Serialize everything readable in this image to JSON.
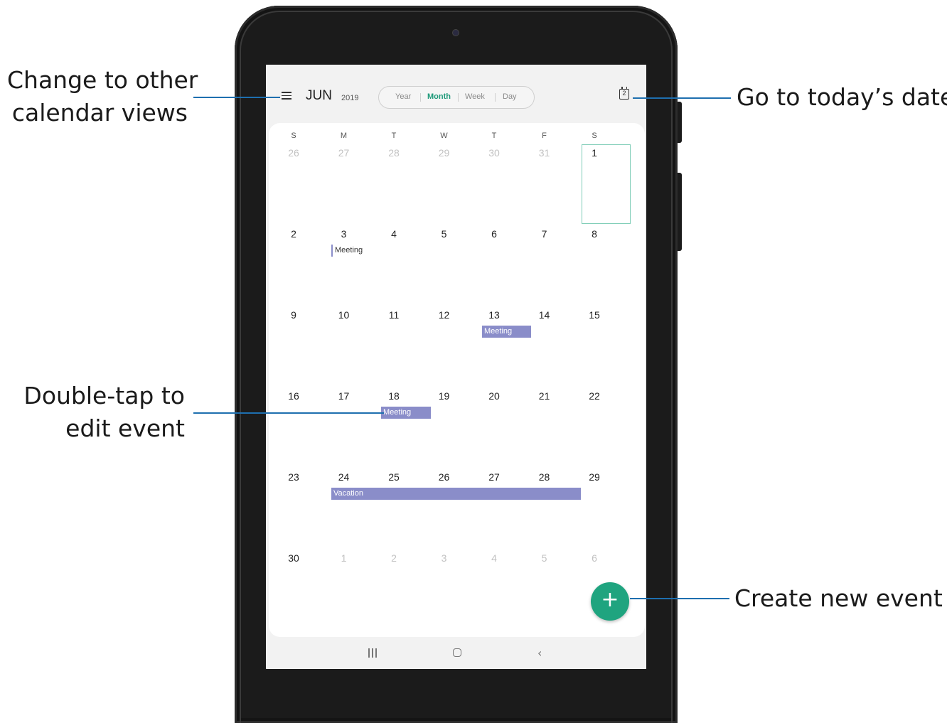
{
  "callouts": {
    "views_line1": "Change to other",
    "views_line2": "calendar views",
    "today": "Go to today’s date",
    "edit_line1": "Double-tap to",
    "edit_line2": "edit event",
    "create": "Create new event"
  },
  "header": {
    "month": "JUN",
    "year": "2019",
    "views": [
      "Year",
      "Month",
      "Week",
      "Day"
    ],
    "active_view": "Month",
    "today_icon_day": "2"
  },
  "weekdays": [
    "S",
    "M",
    "T",
    "W",
    "T",
    "F",
    "S"
  ],
  "weeks": [
    [
      "26",
      "27",
      "28",
      "29",
      "30",
      "31",
      "1"
    ],
    [
      "2",
      "3",
      "4",
      "5",
      "6",
      "7",
      "8"
    ],
    [
      "9",
      "10",
      "11",
      "12",
      "13",
      "14",
      "15"
    ],
    [
      "16",
      "17",
      "18",
      "19",
      "20",
      "21",
      "22"
    ],
    [
      "23",
      "24",
      "25",
      "26",
      "27",
      "28",
      "29"
    ],
    [
      "30",
      "1",
      "2",
      "3",
      "4",
      "5",
      "6"
    ]
  ],
  "events": {
    "meeting_3": "Meeting",
    "meeting_13": "Meeting",
    "meeting_18": "Meeting",
    "vacation": "Vacation"
  },
  "fab_label": "+",
  "colors": {
    "accent": "#1fa47f",
    "event": "#8a8dc9",
    "today_border": "#7fcdb7",
    "callout_line": "#1e6faf"
  }
}
